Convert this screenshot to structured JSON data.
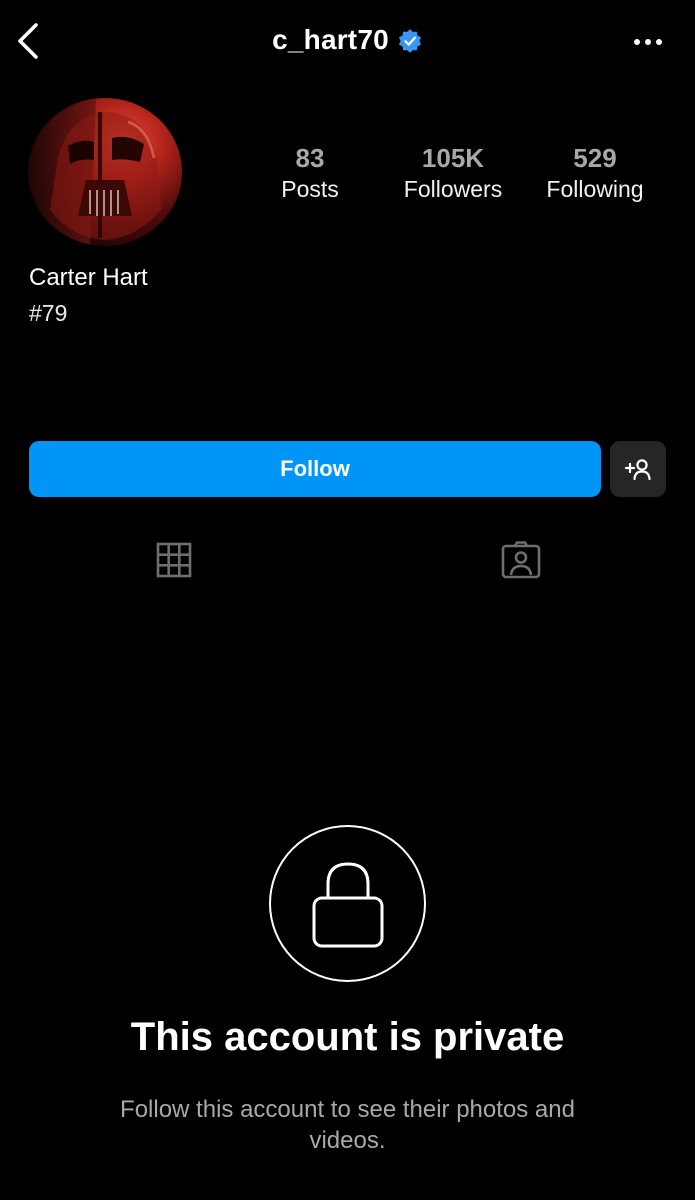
{
  "header": {
    "username": "c_hart70",
    "verified": true,
    "back_icon": "chevron-left-icon",
    "more_icon": "more-horizontal-icon"
  },
  "profile": {
    "display_name": "Carter Hart",
    "bio": "#79",
    "avatar": "darth-vader-helmet-red-avatar",
    "stats": [
      {
        "value": "83",
        "label": "Posts"
      },
      {
        "value": "105K",
        "label": "Followers"
      },
      {
        "value": "529",
        "label": "Following"
      }
    ]
  },
  "actions": {
    "follow_label": "Follow",
    "suggest_icon": "add-person-icon"
  },
  "tabs": [
    {
      "name": "posts-grid",
      "icon": "grid-icon"
    },
    {
      "name": "tagged",
      "icon": "tagged-person-icon"
    }
  ],
  "private_notice": {
    "title": "This account is private",
    "subtitle": "Follow this account to see their photos and videos.",
    "icon": "lock-icon"
  },
  "colors": {
    "background": "#000000",
    "accent": "#0095f6",
    "secondary_button": "#262626",
    "verified_badge": "#3897f0",
    "muted_text": "#a8a8a8"
  }
}
